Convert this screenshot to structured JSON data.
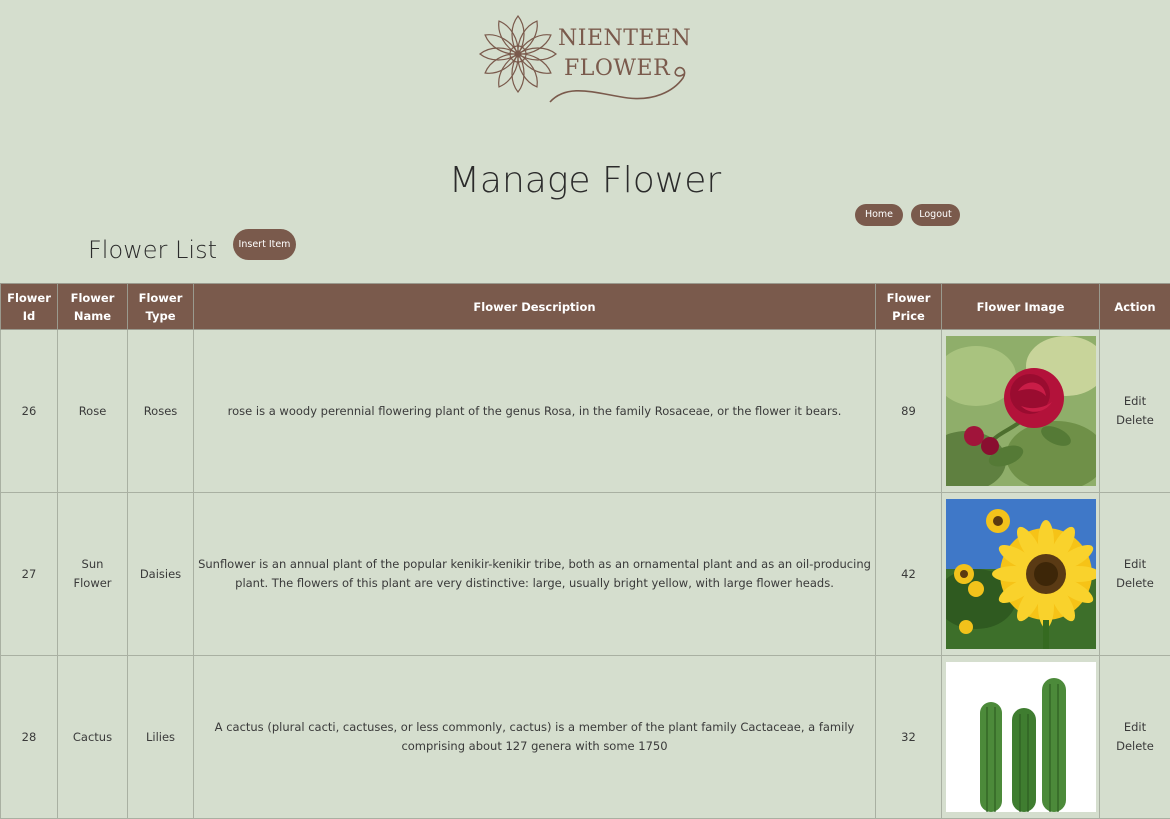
{
  "brand": {
    "name_line1": "NIENTEEN",
    "name_line2": "FLOWER"
  },
  "page_title": "Manage Flower",
  "nav": {
    "home_label": "Home",
    "logout_label": "Logout"
  },
  "list": {
    "title": "Flower List",
    "insert_label": "Insert Item"
  },
  "table": {
    "headers": {
      "id": "Flower Id",
      "name": "Flower Name",
      "type": "Flower Type",
      "description": "Flower Description",
      "price": "Flower Price",
      "image": "Flower Image",
      "action": "Action"
    },
    "rows": [
      {
        "id": "26",
        "name": "Rose",
        "type": "Roses",
        "description": "rose is a woody perennial flowering plant of the genus Rosa, in the family Rosaceae, or the flower it bears.",
        "price": "89",
        "image": "rose-photo",
        "edit": "Edit",
        "delete": "Delete"
      },
      {
        "id": "27",
        "name": "Sun Flower",
        "type": "Daisies",
        "description": "Sunflower is an annual plant of the popular kenikir-kenikir tribe, both as an ornamental plant and as an oil-producing plant. The flowers of this plant are very distinctive: large, usually bright yellow, with large flower heads.",
        "price": "42",
        "image": "sunflower-photo",
        "edit": "Edit",
        "delete": "Delete"
      },
      {
        "id": "28",
        "name": "Cactus",
        "type": "Lilies",
        "description": "A cactus (plural cacti, cactuses, or less commonly, cactus) is a member of the plant family Cactaceae, a family comprising about 127 genera with some 1750",
        "price": "32",
        "image": "cactus-photo",
        "edit": "Edit",
        "delete": "Delete"
      }
    ]
  },
  "colors": {
    "background": "#d5dece",
    "accent": "#7a5a4c",
    "text": "#2d2d2d"
  }
}
